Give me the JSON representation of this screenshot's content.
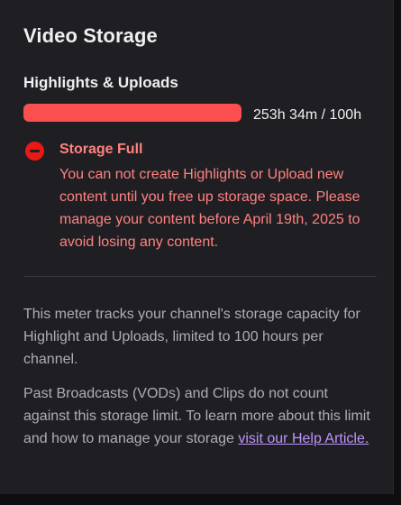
{
  "title": "Video Storage",
  "section": {
    "title": "Highlights & Uploads"
  },
  "meter": {
    "value_text": "253h 34m / 100h",
    "fill_fraction": 1.0,
    "fill_color": "#fb4f4f"
  },
  "alert": {
    "icon": "no-entry-icon",
    "title": "Storage Full",
    "body": "You can not create Highlights or Upload new content until you free up storage space. Please manage your content before April 19th, 2025 to avoid losing any content."
  },
  "info": {
    "paragraph1": "This meter tracks your channel's storage capacity for Highlight and Uploads, limited to 100 hours per channel.",
    "paragraph2_text": "Past Broadcasts (VODs) and Clips do not count against this storage limit. To learn more about this limit and how to manage your storage ",
    "link_text": "visit our Help Article."
  }
}
